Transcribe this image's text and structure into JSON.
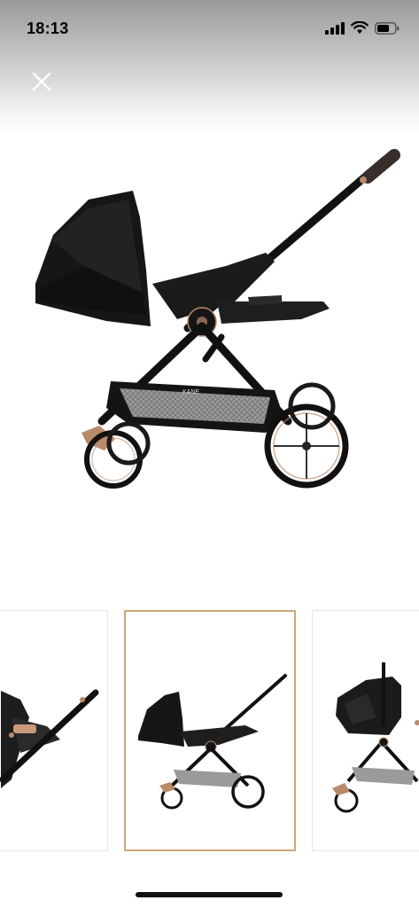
{
  "status_bar": {
    "time": "18:13",
    "icons": [
      "cellular-signal-icon",
      "wifi-icon",
      "battery-icon"
    ]
  },
  "toolbar": {
    "close_icon": "close-icon"
  },
  "main_image": {
    "brand_label": "KANE",
    "colors": {
      "frame": "#111111",
      "fabric": "#1b1b1b",
      "accent": "#b98a6a",
      "basket": "#9a9a9a"
    }
  },
  "gallery": {
    "selected_index": 1,
    "thumbnails": [
      {
        "id": "thumb-1",
        "selected": false
      },
      {
        "id": "thumb-2",
        "selected": true
      },
      {
        "id": "thumb-3",
        "selected": false
      }
    ],
    "selected_border_color": "#c8a97a"
  }
}
